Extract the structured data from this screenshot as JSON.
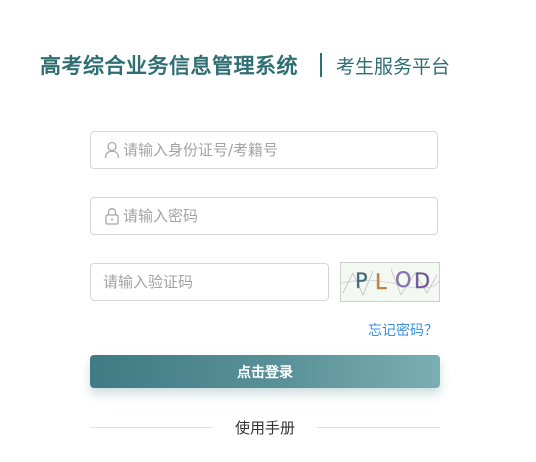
{
  "header": {
    "title": "高考综合业务信息管理系统",
    "subtitle": "考生服务平台"
  },
  "form": {
    "username_placeholder": "请输入身份证号/考籍号",
    "password_placeholder": "请输入密码",
    "captcha_placeholder": "请输入验证码",
    "captcha_text": "PLOD",
    "forgot_label": "忘记密码？",
    "login_label": "点击登录"
  },
  "footer": {
    "manual_label": "使用手册"
  },
  "icons": {
    "username": "user-icon",
    "password": "lock-icon"
  },
  "colors": {
    "brand": "#2f6f74",
    "link": "#3b8fe0",
    "button_start": "#3f7b83",
    "button_end": "#7aaeb3"
  }
}
